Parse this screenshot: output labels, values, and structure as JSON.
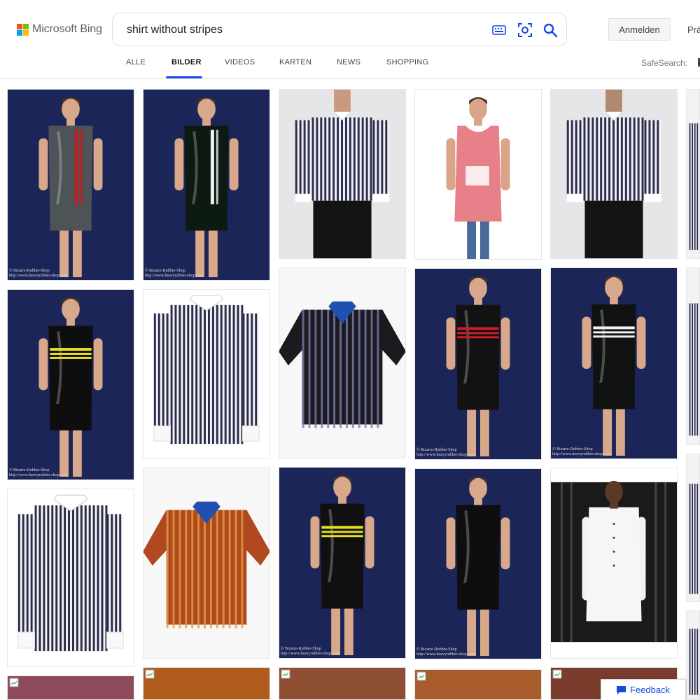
{
  "header": {
    "brand": "Microsoft Bing",
    "logo_colors": [
      "#f25022",
      "#7fba00",
      "#00a4ef",
      "#ffb900"
    ],
    "search": {
      "value": "shirt without stripes",
      "placeholder": ""
    },
    "signin_label": "Anmelden",
    "prefs_label": "Prä"
  },
  "tabs": [
    {
      "label": "ALLE",
      "active": false
    },
    {
      "label": "BILDER",
      "active": true
    },
    {
      "label": "VIDEOS",
      "active": false
    },
    {
      "label": "KARTEN",
      "active": false
    },
    {
      "label": "NEWS",
      "active": false
    },
    {
      "label": "SHOPPING",
      "active": false
    }
  ],
  "safesearch_label": "SafeSearch:",
  "accent_color": "#174ae4",
  "watermark": {
    "line1": "© Bizarre-Rubber-Shop",
    "line2": "http://www.heavyrubber-shop.com"
  },
  "results": [
    {
      "kind": "latex",
      "shirt": "#4d5356",
      "stripe": "#d01818",
      "stripe_style": "vertical",
      "watermark": true
    },
    {
      "kind": "latex",
      "shirt": "#0c1a12",
      "stripe": "#f2f2f2",
      "stripe_style": "vertical",
      "watermark": true
    },
    {
      "kind": "striped-worn",
      "watermark": false
    },
    {
      "kind": "tank",
      "shirt": "#e8808a",
      "watermark": false
    },
    {
      "kind": "striped-back",
      "watermark": false
    },
    {
      "kind": "latex",
      "shirt": "#0e0e0e",
      "stripe": "#e8e020",
      "stripe_style": "horizontal",
      "watermark": true
    },
    {
      "kind": "striped-flat",
      "watermark": false
    },
    {
      "kind": "hawaii",
      "shirt": "#1b1b1f",
      "stripe": "#7b7baa",
      "watermark": false
    },
    {
      "kind": "latex",
      "shirt": "#121212",
      "stripe": "#d21c24",
      "stripe_style": "horizontal",
      "watermark": true
    },
    {
      "kind": "latex",
      "shirt": "#101212",
      "stripe": "#f0f0f0",
      "stripe_style": "horizontal",
      "watermark": true
    },
    {
      "kind": "striped-flat",
      "watermark": false
    },
    {
      "kind": "hawaii",
      "shirt": "#b04820",
      "stripe": "#e0a040",
      "watermark": false
    },
    {
      "kind": "latex",
      "shirt": "#101010",
      "stripe": "#e8e020",
      "stripe_style": "horizontal",
      "watermark": true
    },
    {
      "kind": "latex-back",
      "shirt": "#0e0e0e",
      "watermark": true
    },
    {
      "kind": "white-shirt",
      "watermark": false
    },
    {
      "kind": "partial",
      "watermark": false
    },
    {
      "kind": "partial",
      "watermark": false
    },
    {
      "kind": "partial",
      "watermark": false
    },
    {
      "kind": "partial",
      "watermark": false
    },
    {
      "kind": "loading",
      "color": "#8c4a5a"
    },
    {
      "kind": "loading",
      "color": "#b05c1c"
    },
    {
      "kind": "loading",
      "color": "#8e4e34"
    },
    {
      "kind": "loading",
      "color": "#a85c2c"
    },
    {
      "kind": "loading",
      "color": "#7a3c2c"
    }
  ],
  "feedback_label": "Feedback"
}
